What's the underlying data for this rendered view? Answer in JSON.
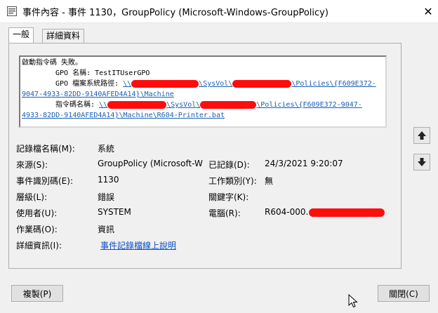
{
  "window": {
    "title": "事件內容 - 事件 1130，GroupPolicy (Microsoft-Windows-GroupPolicy)",
    "close_glyph": "✕"
  },
  "tabs": [
    {
      "label": "一般"
    },
    {
      "label": "詳細資料"
    }
  ],
  "description": {
    "line1": "啟動指令碼 失敗。",
    "line2": "GPO 名稱: TestITUserGPO",
    "line3_label": "GPO 檔案系統路徑: ",
    "line3_p1": "\\\\",
    "line3_p2": "\\SysVol\\",
    "line3_p3": "\\Policies\\{F609E372-",
    "line4": "9047-4933-82DD-9140AFED4A14}\\Machine",
    "line5_label": "指令碼名稱: ",
    "line5_p1": "\\\\",
    "line5_p2": "\\SysVol\\",
    "line5_p3": "\\Policies\\{F609E372-9047-",
    "line6": "4933-82DD-9140AFED4A14}\\Machine\\R604-Printer.bat"
  },
  "fields": {
    "log_name": {
      "label": "記錄檔名稱(M):",
      "value": "系統"
    },
    "source": {
      "label": "來源(S):",
      "value": "GroupPolicy (Microsoft-Win"
    },
    "logged": {
      "label": "已記錄(D):",
      "value": "24/3/2021 9:20:07"
    },
    "event_id": {
      "label": "事件識別碼(E):",
      "value": "1130"
    },
    "task_category": {
      "label": "工作類別(Y):",
      "value": "無"
    },
    "level": {
      "label": "層級(L):",
      "value": "錯誤"
    },
    "keywords": {
      "label": "關鍵字(K):",
      "value": ""
    },
    "user": {
      "label": "使用者(U):",
      "value": "SYSTEM"
    },
    "computer": {
      "label": "電腦(R):",
      "value": "R604-000."
    },
    "opcode": {
      "label": "作業碼(O):",
      "value": "資訊"
    },
    "more_info": {
      "label": "詳細資訊(I):",
      "value": "事件記錄檔線上說明"
    }
  },
  "buttons": {
    "copy": "複製(P)",
    "close": "關閉(C)"
  },
  "icons": {
    "app": "event-properties-icon",
    "up": "arrow-up-icon",
    "down": "arrow-down-icon",
    "cursor": "mouse-cursor-icon"
  },
  "colors": {
    "redaction": "#ff0d0d",
    "link": "#0a4fc5"
  }
}
